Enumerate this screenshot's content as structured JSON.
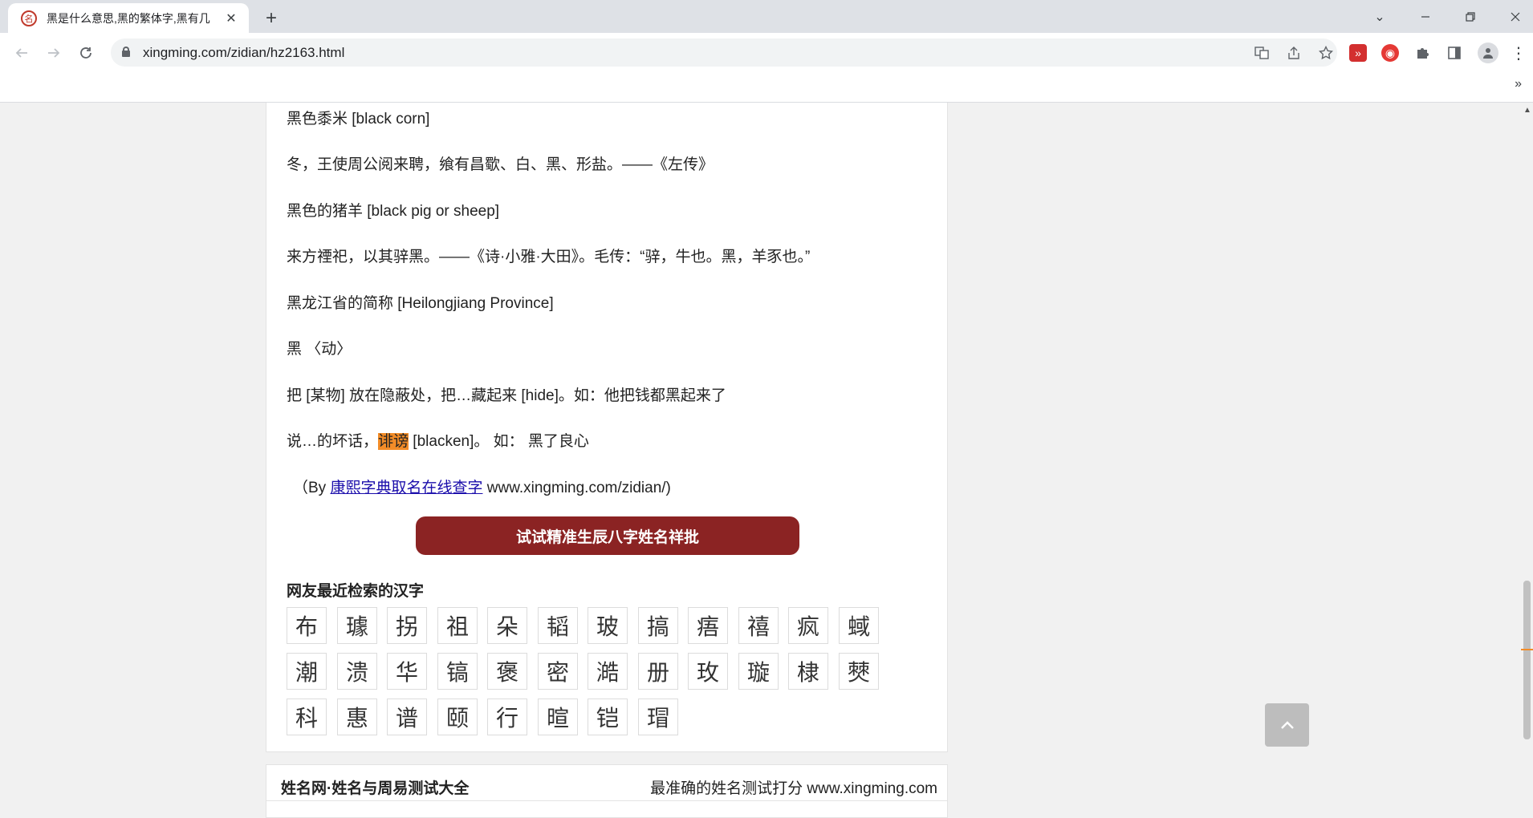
{
  "browser": {
    "tab_title": "黑是什么意思,黑的繁体字,黑有几",
    "url": "xingming.com/zidian/hz2163.html",
    "window_controls": [
      "minimize",
      "restore",
      "close"
    ]
  },
  "definitions": {
    "line1": "黑色黍米 [black corn]",
    "line2": "冬，王使周公阅来聘，飨有昌歜、白、黑、形盐。——《左传》",
    "line3": "黑色的猪羊 [black pig or sheep]",
    "line4": "来方禋祀，以其骍黑。——《诗·小雅·大田》。毛传：“骍，牛也。黑，羊豕也。”",
    "line5": "黑龙江省的简称 [Heilongjiang Province]",
    "line6": "黑 〈动〉",
    "line7": "把 [某物] 放在隐蔽处，把…藏起来 [hide]。如：他把钱都黑起来了",
    "line8_pre": "说…的坏话，",
    "line8_hl": "诽谤",
    "line8_post": " [blacken]。 如：  黑了良心"
  },
  "credit": {
    "prefix": "（By ",
    "link": "康熙字典取名在线查字",
    "suffix": " www.xingming.com/zidian/)"
  },
  "cta_label": "试试精准生辰八字姓名祥批",
  "recent": {
    "title": "网友最近检索的汉字",
    "chars": [
      "布",
      "璩",
      "拐",
      "祖",
      "朵",
      "韬",
      "玻",
      "搞",
      "痦",
      "禧",
      "疯",
      "蜮",
      "潮",
      "溃",
      "华",
      "镐",
      "褒",
      "密",
      "澔",
      "册",
      "玫",
      "璇",
      "棣",
      "僰",
      "科",
      "惠",
      "谱",
      "颐",
      "行",
      "暄",
      "铠",
      "瑁"
    ]
  },
  "footer": {
    "left": "姓名网·姓名与周易测试大全",
    "right": "最准确的姓名测试打分 www.xingming.com"
  },
  "colors": {
    "cta_bg": "#8b2323",
    "highlight": "#f28c28",
    "link": "#1a0dab"
  }
}
